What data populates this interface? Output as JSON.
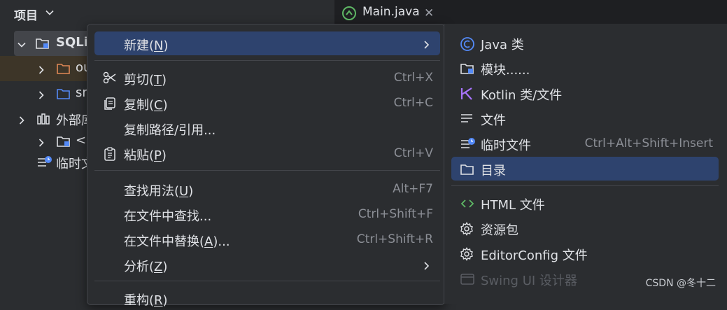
{
  "project_panel": {
    "title": "项目",
    "tree": [
      {
        "label": "SQLi"
      },
      {
        "label": "ou"
      },
      {
        "label": "sr"
      },
      {
        "label": "外部库"
      },
      {
        "label": "<"
      },
      {
        "label": "临时文"
      }
    ]
  },
  "editor_tab": {
    "label": "Main.java",
    "close": "✕"
  },
  "context_menu": {
    "items": [
      {
        "label": "新建(",
        "mnemonic": "N",
        "suffix": ")",
        "shortcut": "",
        "icon": "none"
      },
      {
        "label": "剪切(",
        "mnemonic": "T",
        "suffix": ")",
        "shortcut": "Ctrl+X",
        "icon": "scissors-icon"
      },
      {
        "label": "复制(",
        "mnemonic": "C",
        "suffix": ")",
        "shortcut": "Ctrl+C",
        "icon": "copy-icon"
      },
      {
        "label": "复制路径/引用...",
        "mnemonic": "",
        "suffix": "",
        "shortcut": "",
        "icon": "none"
      },
      {
        "label": "粘贴(",
        "mnemonic": "P",
        "suffix": ")",
        "shortcut": "Ctrl+V",
        "icon": "clipboard-icon"
      },
      {
        "label": "查找用法(",
        "mnemonic": "U",
        "suffix": ")",
        "shortcut": "Alt+F7",
        "icon": "none"
      },
      {
        "label": "在文件中查找...",
        "mnemonic": "",
        "suffix": "",
        "shortcut": "Ctrl+Shift+F",
        "icon": "none"
      },
      {
        "label": "在文件中替换(",
        "mnemonic": "A",
        "suffix": ")...",
        "shortcut": "Ctrl+Shift+R",
        "icon": "none"
      },
      {
        "label": "分析(",
        "mnemonic": "Z",
        "suffix": ")",
        "shortcut": "",
        "icon": "none"
      },
      {
        "label": "重构(",
        "mnemonic": "R",
        "suffix": ")",
        "shortcut": "",
        "icon": "none"
      }
    ]
  },
  "submenu": {
    "items": [
      {
        "label": "Java 类",
        "shortcut": "",
        "icon": "java-class-icon"
      },
      {
        "label": "模块......",
        "shortcut": "",
        "icon": "module-icon"
      },
      {
        "label": "Kotlin 类/文件",
        "shortcut": "",
        "icon": "kotlin-icon"
      },
      {
        "label": "文件",
        "shortcut": "",
        "icon": "text-file-icon"
      },
      {
        "label": "临时文件",
        "shortcut": "Ctrl+Alt+Shift+Insert",
        "icon": "scratch-file-icon"
      },
      {
        "label": "目录",
        "shortcut": "",
        "icon": "folder-icon"
      },
      {
        "label": "HTML 文件",
        "shortcut": "",
        "icon": "html-icon"
      },
      {
        "label": "资源包",
        "shortcut": "",
        "icon": "gear-icon"
      },
      {
        "label": "EditorConfig 文件",
        "shortcut": "",
        "icon": "gear-icon"
      },
      {
        "label": "Swing UI 设计器",
        "shortcut": "",
        "icon": "form-icon"
      }
    ]
  },
  "watermark": "CSDN @冬十二",
  "colors": {
    "background": "#2b2d30",
    "selection": "#2e436e",
    "accent_blue": "#548af7",
    "kotlin": "#a974ff",
    "html": "#5fb865"
  }
}
